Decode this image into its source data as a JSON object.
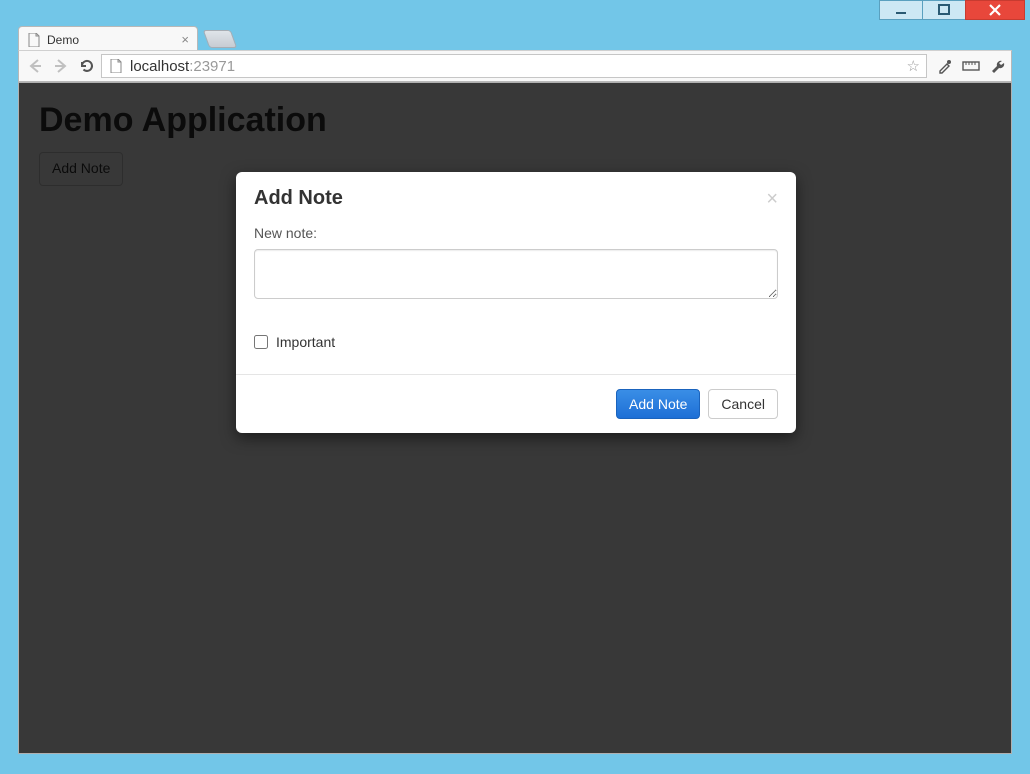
{
  "browser": {
    "tab_title": "Demo",
    "url_host": "localhost",
    "url_port": ":23971"
  },
  "page": {
    "heading": "Demo Application",
    "add_note_btn": "Add Note"
  },
  "modal": {
    "title": "Add Note",
    "label_new_note": "New note:",
    "textarea_value": "",
    "important_label": "Important",
    "important_checked": false,
    "submit_label": "Add Note",
    "cancel_label": "Cancel"
  }
}
